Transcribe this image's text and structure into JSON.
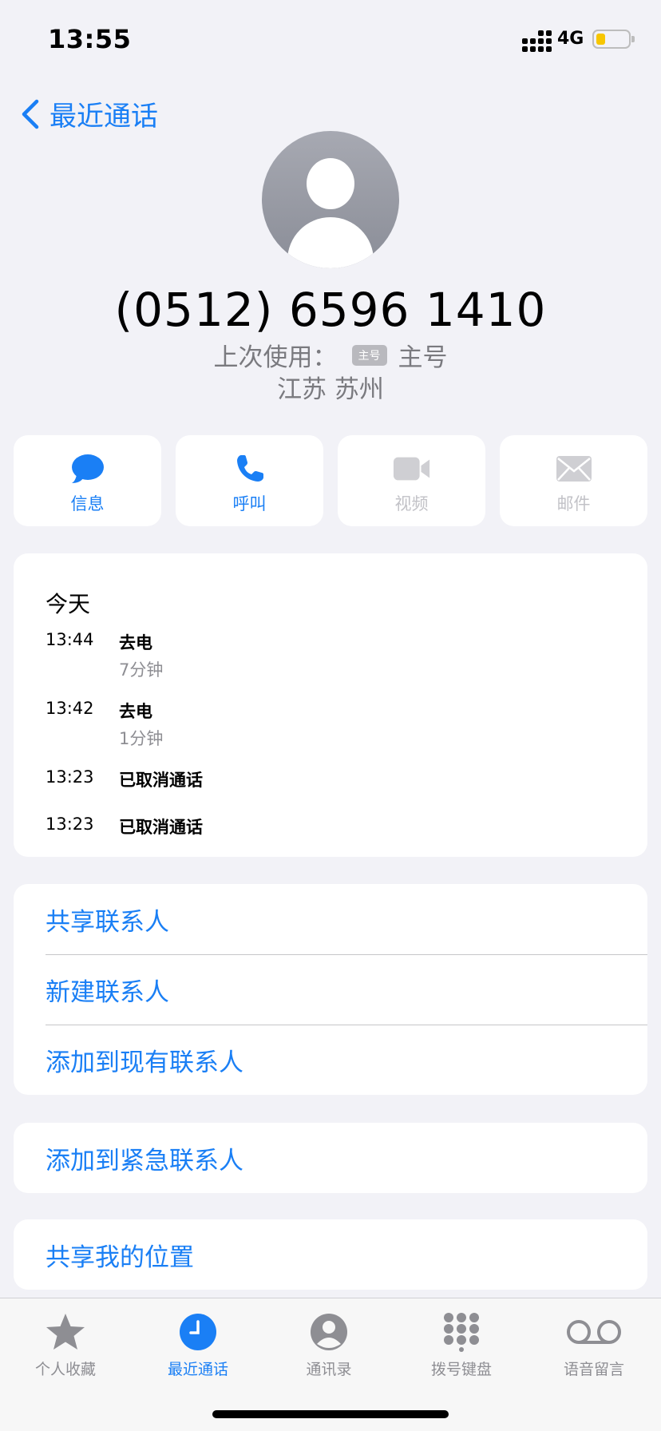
{
  "status_bar": {
    "time": "13:55",
    "network": "4G"
  },
  "nav": {
    "back_label": "最近通话"
  },
  "contact": {
    "phone": "(0512) 6596 1410",
    "last_used_label": "上次使用：",
    "sim_badge": "主号",
    "sim_name": "主号",
    "location": "江苏 苏州"
  },
  "actions": [
    {
      "label": "信息",
      "icon": "message-bubble-icon",
      "enabled": true
    },
    {
      "label": "呼叫",
      "icon": "phone-icon",
      "enabled": true
    },
    {
      "label": "视频",
      "icon": "video-icon",
      "enabled": false
    },
    {
      "label": "邮件",
      "icon": "mail-icon",
      "enabled": false
    }
  ],
  "history": {
    "day": "今天",
    "calls": [
      {
        "time": "13:44",
        "type": "去电",
        "duration": "7分钟"
      },
      {
        "time": "13:42",
        "type": "去电",
        "duration": "1分钟"
      },
      {
        "time": "13:23",
        "type": "已取消通话",
        "duration": ""
      },
      {
        "time": "13:23",
        "type": "已取消通话",
        "duration": ""
      }
    ]
  },
  "contact_actions": {
    "share": "共享联系人",
    "new": "新建联系人",
    "add_existing": "添加到现有联系人"
  },
  "emergency": {
    "add": "添加到紧急联系人"
  },
  "location_share": {
    "label": "共享我的位置"
  },
  "tabs": [
    {
      "label": "个人收藏",
      "icon": "star-icon",
      "active": false
    },
    {
      "label": "最近通话",
      "icon": "clock-icon",
      "active": true
    },
    {
      "label": "通讯录",
      "icon": "person-circle-icon",
      "active": false
    },
    {
      "label": "拨号键盘",
      "icon": "keypad-icon",
      "active": false
    },
    {
      "label": "语音留言",
      "icon": "voicemail-icon",
      "active": false
    }
  ],
  "colors": {
    "accent": "#1a7ff5",
    "background": "#f2f2f7",
    "disabled": "#c2c2c7",
    "battery": "#f7c600"
  }
}
